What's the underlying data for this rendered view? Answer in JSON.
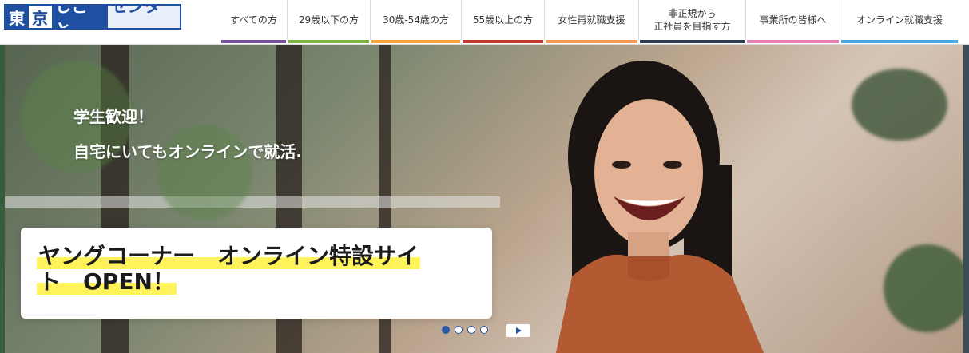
{
  "header": {
    "logo": {
      "blocks": [
        "東",
        "京",
        "しごと",
        "センター"
      ]
    },
    "nav": [
      {
        "label": "すべての方",
        "color": "#7b4fa0"
      },
      {
        "label": "29歳以下の方",
        "color": "#7cb342"
      },
      {
        "label": "30歳-54歳の方",
        "color": "#f2a33a"
      },
      {
        "label": "55歳以上の方",
        "color": "#c0392b"
      },
      {
        "label": "女性再就職支援",
        "color": "#f39c5a"
      },
      {
        "label_line1": "非正規から",
        "label_line2": "正社員を目指す方",
        "color": "#2c3e50"
      },
      {
        "label": "事業所の皆様へ",
        "color": "#e77fb3"
      },
      {
        "label": "オンライン就職支援",
        "color": "#4aa8df"
      }
    ]
  },
  "hero": {
    "headline_line1": "学生歓迎！",
    "headline_line2": "自宅にいてもオンラインで就活.",
    "promo": {
      "line1": "ヤングコーナー　オンライン特設サイ",
      "line2": "ト　OPEN！"
    },
    "carousel": {
      "total": 4,
      "active_index": 0
    },
    "colors": {
      "highlight": "#fff25a",
      "dot": "#2a5aa7"
    }
  }
}
